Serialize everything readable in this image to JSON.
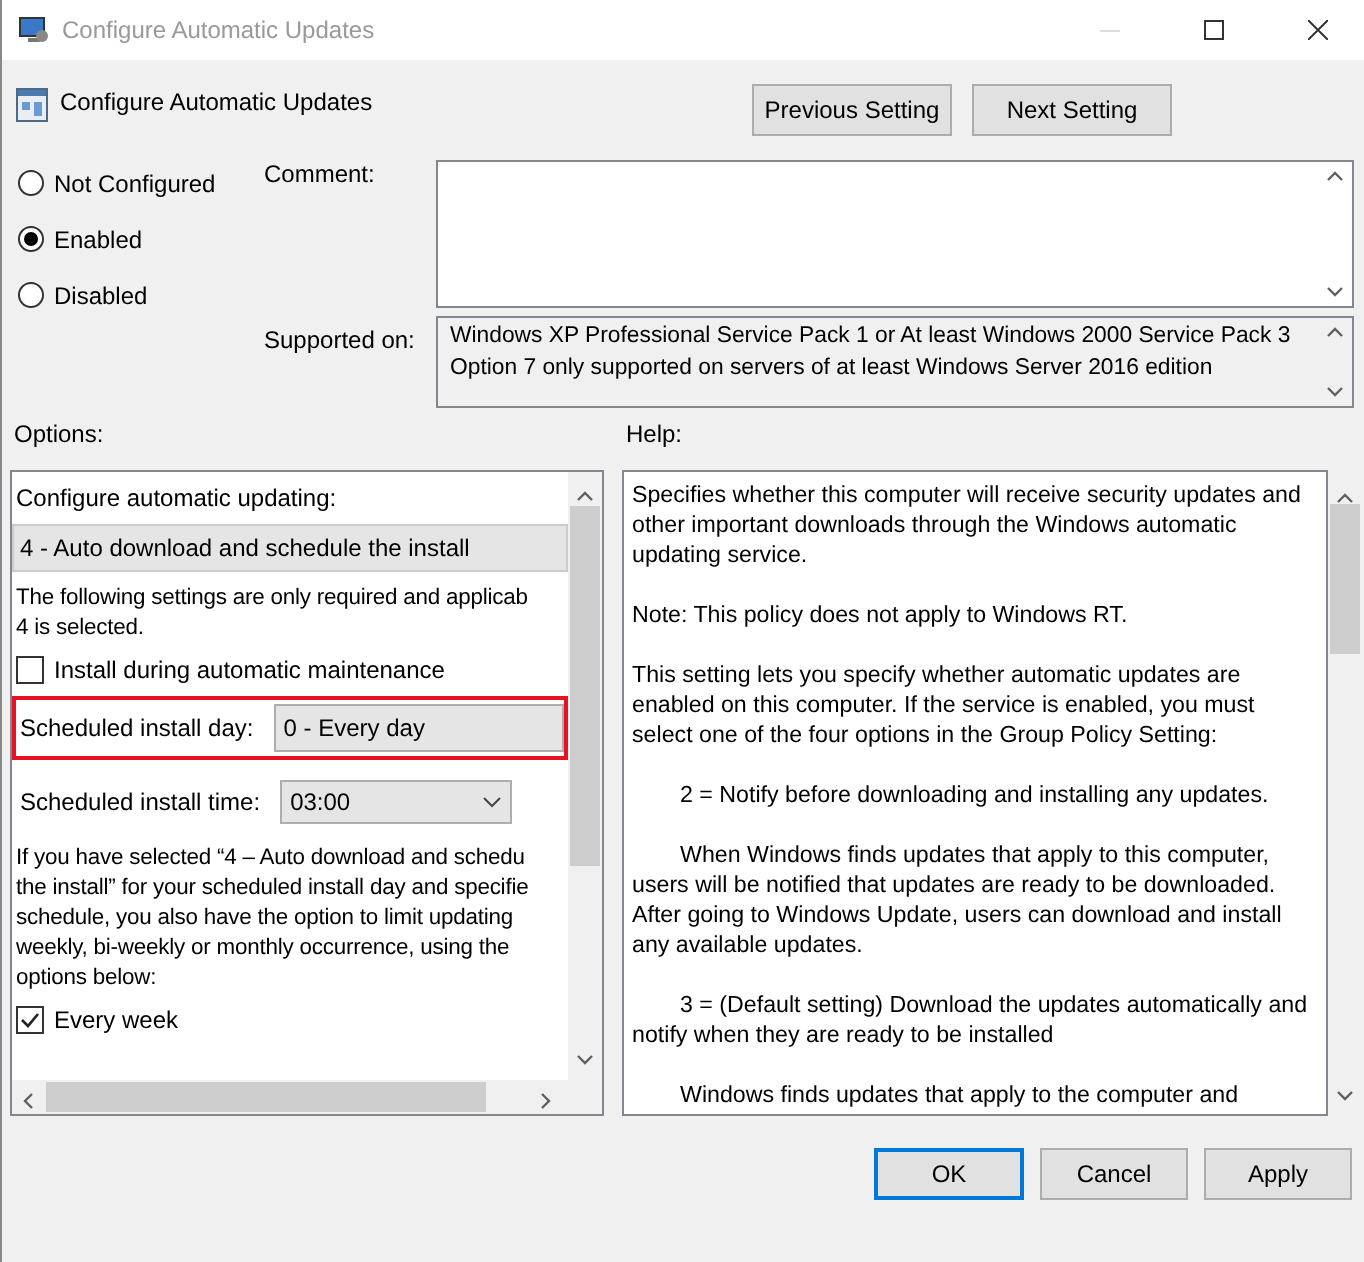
{
  "window": {
    "title": "Configure Automatic Updates"
  },
  "policy_title": "Configure Automatic Updates",
  "nav_buttons": [
    "Previous Setting",
    "Next Setting"
  ],
  "state_options": [
    {
      "label": "Not Configured",
      "selected": false
    },
    {
      "label": "Enabled",
      "selected": true
    },
    {
      "label": "Disabled",
      "selected": false
    }
  ],
  "comment": {
    "label": "Comment:"
  },
  "supported_on": {
    "label": "Supported on:",
    "lines": [
      "Windows XP Professional Service Pack 1 or At least Windows 2000 Service Pack 3",
      "Option 7 only supported on servers of at least Windows Server 2016 edition"
    ]
  },
  "options": {
    "label": "Options:",
    "items": [
      {
        "kind": "label",
        "text": "Configure automatic updating:"
      },
      {
        "kind": "select",
        "value": "4 - Auto download and schedule the install"
      },
      {
        "kind": "text",
        "lines": [
          "The following settings are only required and applicab",
          "4 is selected."
        ]
      },
      {
        "kind": "checkbox",
        "label": "Install during automatic maintenance",
        "checked": false
      },
      {
        "kind": "field",
        "label": "Scheduled install day:",
        "value": "0 - Every day",
        "highlighted": true
      },
      {
        "kind": "dropdown",
        "label": "Scheduled install time:",
        "value": "03:00"
      },
      {
        "kind": "text",
        "lines": [
          "If you have selected “4 – Auto download and schedu",
          "the install” for your scheduled install day and specifie",
          "schedule, you also have the option to limit updating",
          "weekly, bi-weekly or monthly occurrence, using the",
          "options below:"
        ]
      },
      {
        "kind": "checkbox",
        "label": "Every week",
        "checked": true
      }
    ]
  },
  "help": {
    "label": "Help:",
    "paragraphs": [
      {
        "text": "Specifies whether this computer will receive security updates and other important downloads through the Windows automatic updating service.",
        "indent": false
      },
      {
        "text": "Note: This policy does not apply to Windows RT.",
        "indent": false
      },
      {
        "text": "This setting lets you specify whether automatic updates are enabled on this computer. If the service is enabled, you must select one of the four options in the Group Policy Setting:",
        "indent": false
      },
      {
        "text": "2 = Notify before downloading and installing any updates.",
        "indent": true
      },
      {
        "text": "When Windows finds updates that apply to this computer, users will be notified that updates are ready to be downloaded. After going to Windows Update, users can download and install any available updates.",
        "indent": true
      },
      {
        "text": "3 = (Default setting) Download the updates automatically and notify when they are ready to be installed",
        "indent": true
      },
      {
        "text": "Windows finds updates that apply to the computer and",
        "indent": true
      }
    ]
  },
  "buttons": [
    {
      "label": "OK",
      "selected": true
    },
    {
      "label": "Cancel",
      "selected": false
    },
    {
      "label": "Apply",
      "selected": false
    }
  ]
}
